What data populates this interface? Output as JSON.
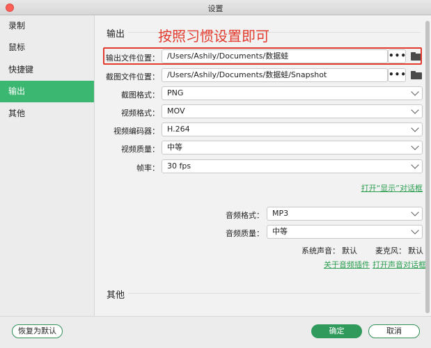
{
  "window": {
    "title": "设置"
  },
  "sidebar": {
    "items": [
      {
        "label": "录制"
      },
      {
        "label": "鼠标"
      },
      {
        "label": "快捷键"
      },
      {
        "label": "输出"
      },
      {
        "label": "其他"
      }
    ],
    "active": "输出"
  },
  "annotation": "按照习惯设置即可",
  "output_section": {
    "title": "输出",
    "output_location": {
      "label": "输出文件位置：",
      "value": "/Users/Ashily/Documents/数据蛙",
      "browse": "•••"
    },
    "screenshot_location": {
      "label": "截图文件位置：",
      "value": "/Users/Ashily/Documents/数据蛙/Snapshot",
      "browse": "•••"
    },
    "screenshot_format": {
      "label": "截图格式：",
      "value": "PNG"
    },
    "video_format": {
      "label": "视频格式：",
      "value": "MOV"
    },
    "video_codec": {
      "label": "视频编码器：",
      "value": "H.264"
    },
    "video_quality": {
      "label": "视频质量：",
      "value": "中等"
    },
    "frame_rate": {
      "label": "帧率：",
      "value": "30 fps"
    },
    "open_display_dialog": "打开“显示”对话框",
    "audio_format": {
      "label": "音频格式：",
      "value": "MP3"
    },
    "audio_quality": {
      "label": "音频质量：",
      "value": "中等"
    },
    "system_sound": {
      "label": "系统声音：",
      "value": "默认"
    },
    "microphone": {
      "label": "麦克风：",
      "value": "默认"
    },
    "about_audio_plugin": "关于音频插件",
    "open_audio_dialog": "打开声音对话框"
  },
  "other_section": {
    "title": "其他"
  },
  "footer": {
    "restore_default": "恢复为默认",
    "ok": "确定",
    "cancel": "取消"
  },
  "colors": {
    "accent": "#3cb771",
    "annotation": "#e23a2c",
    "link": "#2a9d4f"
  }
}
